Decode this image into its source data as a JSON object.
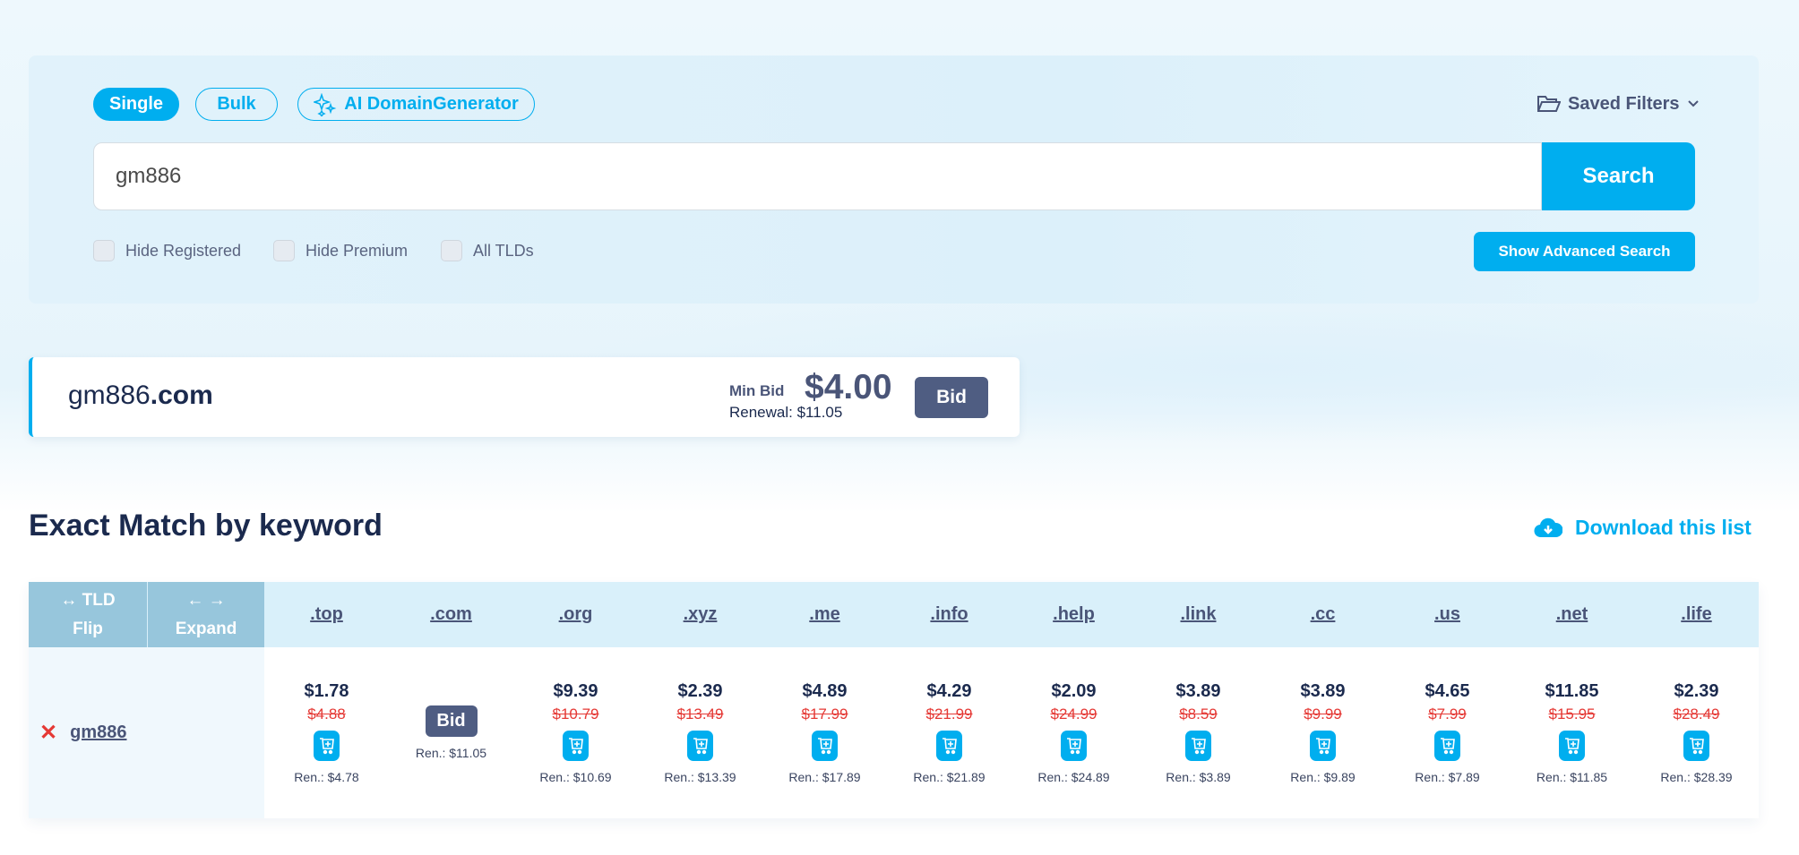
{
  "search": {
    "tabs": [
      "Single",
      "Bulk",
      "AI DomainGenerator"
    ],
    "saved_filters": "Saved Filters",
    "query": "gm886",
    "button": "Search",
    "filters": [
      "Hide Registered",
      "Hide Premium",
      "All TLDs"
    ],
    "advanced": "Show Advanced Search"
  },
  "featured": {
    "name": "gm886",
    "tld": ".com",
    "min_bid_label": "Min Bid",
    "min_bid": "$4.00",
    "renewal": "Renewal: $11.05",
    "bid": "Bid"
  },
  "results": {
    "title": "Exact Match by keyword",
    "download": "Download this list",
    "flip_top": "TLD",
    "flip": "Flip",
    "expand": "Expand",
    "keyword": "gm886",
    "columns": [
      {
        "tld": ".top",
        "price": "$1.78",
        "old": "$4.88",
        "ren": "Ren.: $4.78"
      },
      {
        "tld": ".com",
        "bid": "Bid",
        "ren": "Ren.: $11.05"
      },
      {
        "tld": ".org",
        "price": "$9.39",
        "old": "$10.79",
        "ren": "Ren.: $10.69"
      },
      {
        "tld": ".xyz",
        "price": "$2.39",
        "old": "$13.49",
        "ren": "Ren.: $13.39"
      },
      {
        "tld": ".me",
        "price": "$4.89",
        "old": "$17.99",
        "ren": "Ren.: $17.89"
      },
      {
        "tld": ".info",
        "price": "$4.29",
        "old": "$21.99",
        "ren": "Ren.: $21.89"
      },
      {
        "tld": ".help",
        "price": "$2.09",
        "old": "$24.99",
        "ren": "Ren.: $24.89"
      },
      {
        "tld": ".link",
        "price": "$3.89",
        "old": "$8.59",
        "ren": "Ren.: $3.89"
      },
      {
        "tld": ".cc",
        "price": "$3.89",
        "old": "$9.99",
        "ren": "Ren.: $9.89"
      },
      {
        "tld": ".us",
        "price": "$4.65",
        "old": "$7.99",
        "ren": "Ren.: $7.89"
      },
      {
        "tld": ".net",
        "price": "$11.85",
        "old": "$15.95",
        "ren": "Ren.: $11.85"
      },
      {
        "tld": ".life",
        "price": "$2.39",
        "old": "$28.49",
        "ren": "Ren.: $28.39"
      }
    ]
  },
  "colors": {
    "accent": "#00aeef",
    "bid": "#4f5d82",
    "strike": "#e53935",
    "text": "#1b2a4e"
  }
}
